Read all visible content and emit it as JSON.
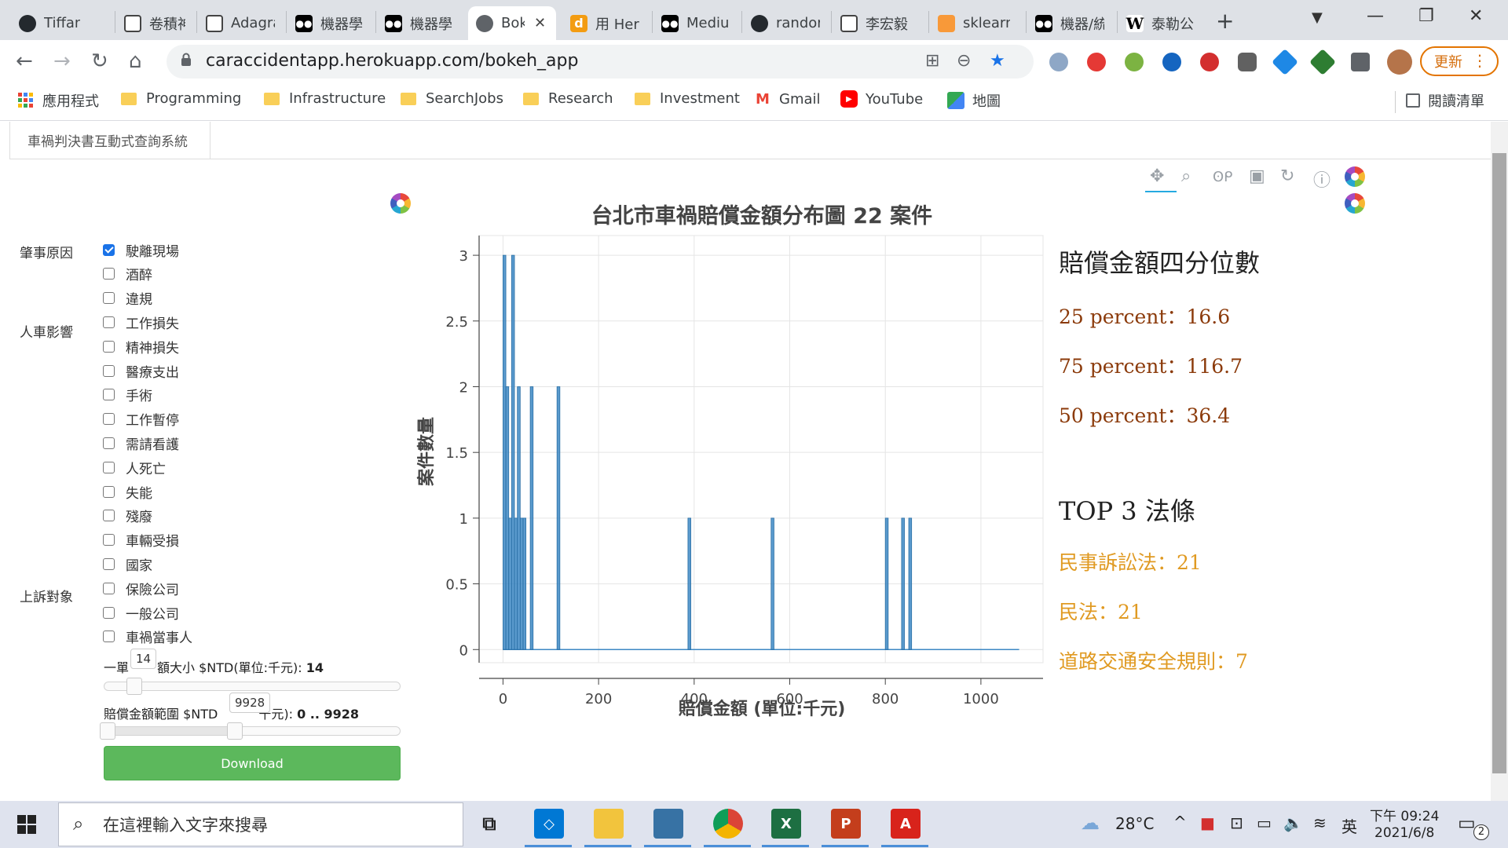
{
  "browser": {
    "tabs": [
      {
        "title": "Tiffany",
        "icon": "github-icon"
      },
      {
        "title": "卷積神",
        "icon": "doc-icon"
      },
      {
        "title": "Adagra",
        "icon": "doc-icon"
      },
      {
        "title": "機器學",
        "icon": "medium-icon"
      },
      {
        "title": "機器學",
        "icon": "medium-icon"
      },
      {
        "title": "Bok",
        "icon": "globe-icon",
        "active": true
      },
      {
        "title": "用 Her",
        "icon": "dev-icon"
      },
      {
        "title": "Mediu",
        "icon": "medium-icon"
      },
      {
        "title": "randor",
        "icon": "github-icon"
      },
      {
        "title": "李宏毅",
        "icon": "doc-icon"
      },
      {
        "title": "sklearn",
        "icon": "sklearn-icon"
      },
      {
        "title": "機器/統",
        "icon": "medium-icon"
      },
      {
        "title": "泰勒公",
        "icon": "wikipedia-icon"
      }
    ],
    "url": "caraccidentapp.herokuapp.com/bokeh_app",
    "update_label": "更新",
    "bookmarks": [
      {
        "label": "應用程式",
        "icon": "apps-grid-icon"
      },
      {
        "label": "Programming",
        "icon": "folder-icon"
      },
      {
        "label": "Infrastructure",
        "icon": "folder-icon"
      },
      {
        "label": "SearchJobs",
        "icon": "folder-icon"
      },
      {
        "label": "Research",
        "icon": "folder-icon"
      },
      {
        "label": "Investment",
        "icon": "folder-icon"
      },
      {
        "label": "Gmail",
        "icon": "gmail-icon"
      },
      {
        "label": "YouTube",
        "icon": "youtube-icon"
      },
      {
        "label": "地圖",
        "icon": "maps-icon"
      }
    ],
    "reading_list_label": "閱讀清單"
  },
  "page": {
    "tab_label": "車禍判決書互動式查詢系統",
    "groups": {
      "cause": "肇事原因",
      "impact": "人車影響",
      "appeal": "上訴對象"
    },
    "checkboxes": [
      {
        "label": "駛離現場",
        "checked": true
      },
      {
        "label": "酒醉",
        "checked": false
      },
      {
        "label": "違規",
        "checked": false
      },
      {
        "label": "工作損失",
        "checked": false
      },
      {
        "label": "精神損失",
        "checked": false
      },
      {
        "label": "醫療支出",
        "checked": false
      },
      {
        "label": "手術",
        "checked": false
      },
      {
        "label": "工作暫停",
        "checked": false
      },
      {
        "label": "需請看護",
        "checked": false
      },
      {
        "label": "人死亡",
        "checked": false
      },
      {
        "label": "失能",
        "checked": false
      },
      {
        "label": "殘廢",
        "checked": false
      },
      {
        "label": "車輛受損",
        "checked": false
      },
      {
        "label": "國家",
        "checked": false
      },
      {
        "label": "保險公司",
        "checked": false
      },
      {
        "label": "一般公司",
        "checked": false
      },
      {
        "label": "車禍當事人",
        "checked": false
      }
    ],
    "slider1": {
      "title_a": "一單",
      "title_b": "額大小 $NTD(單位:千元): ",
      "value": "14",
      "tooltip": "14",
      "fraction": 0.1
    },
    "slider2": {
      "title_a": "賠償金額範圍 $NTD",
      "title_b": "千元): ",
      "value": "0 .. 9928",
      "tooltip": "9928",
      "fraction": 0.44
    },
    "download_label": "Download",
    "stats": {
      "quartile_heading": "賠償金額四分位數",
      "p25": "25 percent：16.6",
      "p75": "75 percent：116.7",
      "p50": "50 percent：36.4",
      "law_heading": "TOP 3 法條",
      "law1": "民事訴訟法：21",
      "law2": "民法：21",
      "law3": "道路交通安全規則：7",
      "quartile_color": "#8b3a0a",
      "law_color": "#e09a22"
    }
  },
  "chart_data": {
    "type": "bar",
    "title": "台北市車禍賠償金額分布圖 22 案件",
    "xlabel": "賠償金額 (單位:千元)",
    "ylabel": "案件數量",
    "xlim": [
      -50,
      1130
    ],
    "ylim": [
      -0.1,
      3.15
    ],
    "xticks": [
      "0",
      "200",
      "400",
      "600",
      "800",
      "1000"
    ],
    "yticks": [
      "0",
      "0.5",
      "1",
      "1.5",
      "2",
      "2.5",
      "3"
    ],
    "bar_color": "#3d88c4",
    "bar_width": 6,
    "bars": [
      {
        "x": 3,
        "y": 3
      },
      {
        "x": 9,
        "y": 2
      },
      {
        "x": 15,
        "y": 1
      },
      {
        "x": 21,
        "y": 3
      },
      {
        "x": 27,
        "y": 1
      },
      {
        "x": 33,
        "y": 2
      },
      {
        "x": 39,
        "y": 1
      },
      {
        "x": 45,
        "y": 1
      },
      {
        "x": 60,
        "y": 2
      },
      {
        "x": 116,
        "y": 2
      },
      {
        "x": 390,
        "y": 1
      },
      {
        "x": 564,
        "y": 1
      },
      {
        "x": 803,
        "y": 1
      },
      {
        "x": 837,
        "y": 1
      },
      {
        "x": 852,
        "y": 1
      }
    ],
    "baseline_end": 1080,
    "grid": true
  },
  "taskbar": {
    "search_placeholder": "在這裡輸入文字來搜尋",
    "weather": "28°C",
    "ime": "英",
    "time": "下午 09:24",
    "date": "2021/6/8",
    "notification_count": "2"
  },
  "colors": {
    "accent_orange": "#e37400",
    "download_green": "#5cb85c",
    "checkbox_blue": "#1a73e8"
  }
}
